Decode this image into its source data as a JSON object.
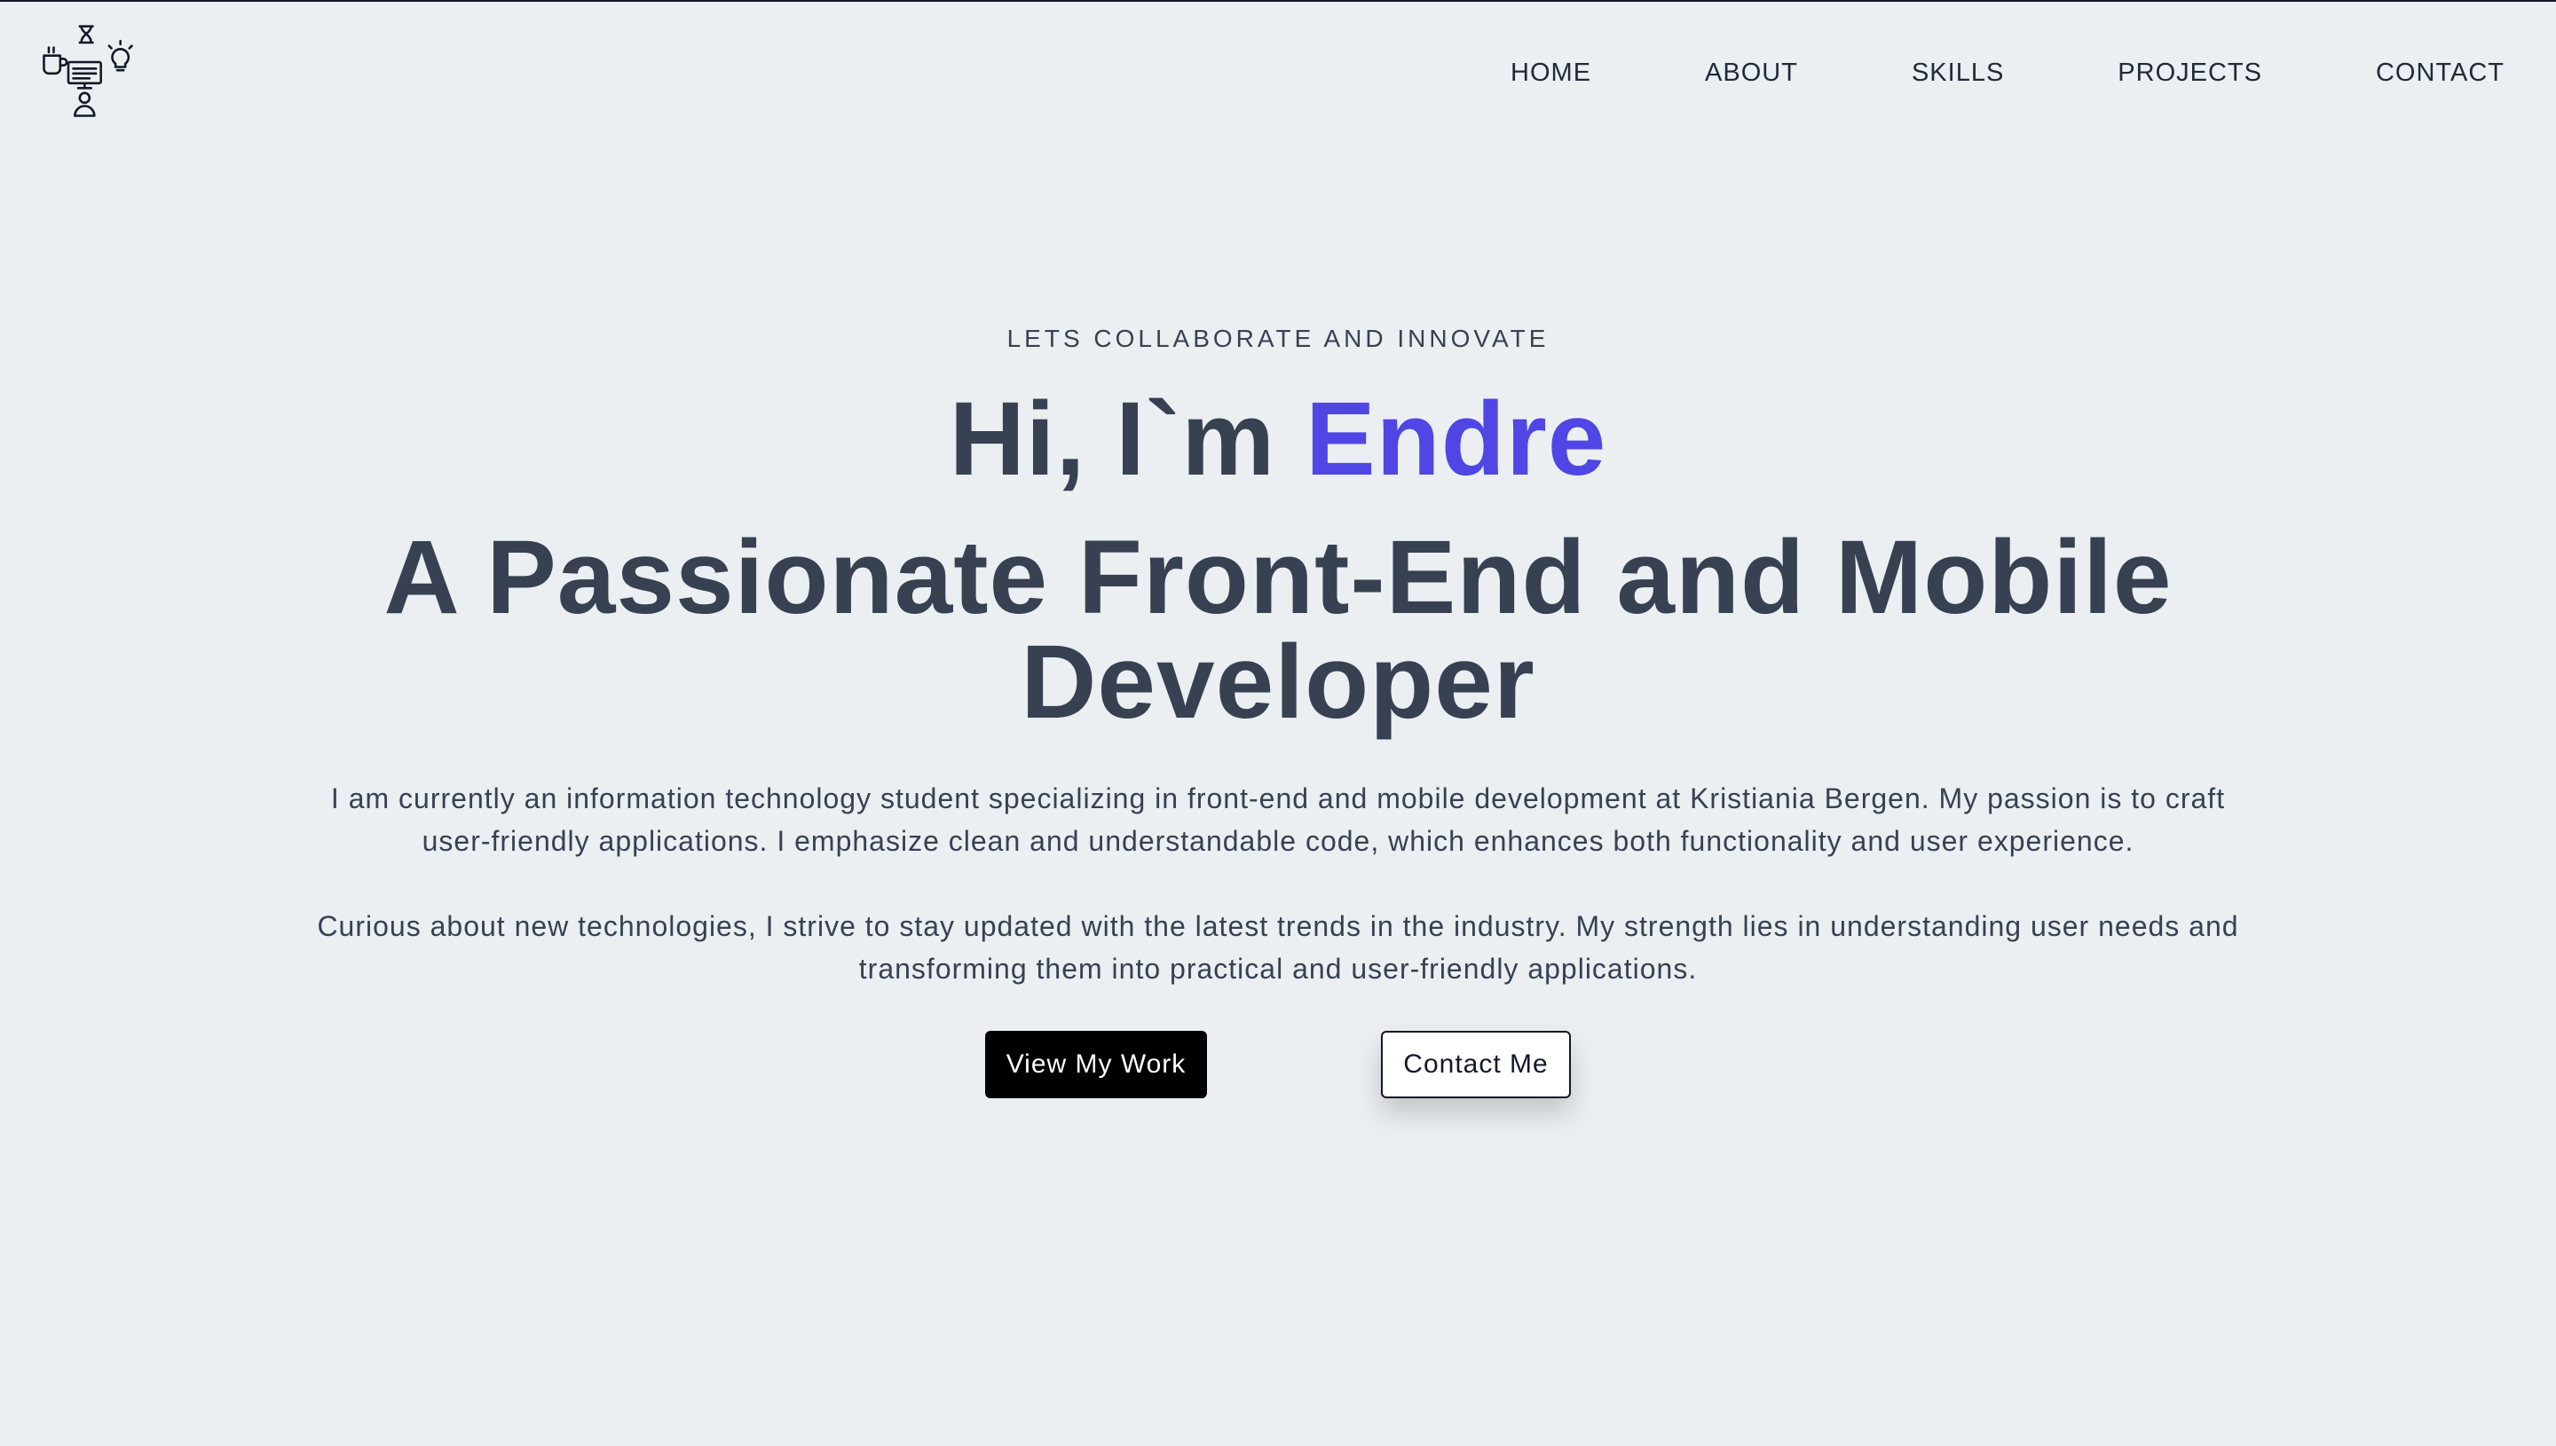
{
  "nav": {
    "items": [
      {
        "label": "HOME"
      },
      {
        "label": "ABOUT"
      },
      {
        "label": "SKILLS"
      },
      {
        "label": "PROJECTS"
      },
      {
        "label": "CONTACT"
      }
    ]
  },
  "hero": {
    "eyebrow": "LETS COLLABORATE AND INNOVATE",
    "greeting": "Hi, I`m",
    "name": "Endre",
    "headline_line1": "A Passionate Front-End and Mobile",
    "headline_line2": "Developer",
    "paragraph1": "I am currently an information technology student specializing in front-end and mobile development at Kristiania Bergen. My passion is to craft user-friendly applications. I emphasize clean and understandable code, which enhances both functionality and user experience.",
    "paragraph2": "Curious about new technologies, I strive to stay updated with the latest trends in the industry. My strength lies in understanding user needs and transforming them into practical and user-friendly applications.",
    "primary_button": "View My Work",
    "secondary_button": "Contact Me"
  },
  "colors": {
    "background": "#ebeff2",
    "text": "#374151",
    "accent": "#4f46e5",
    "primary_button_bg": "#000000"
  },
  "icons": {
    "logo": "developer-workspace-icon"
  }
}
